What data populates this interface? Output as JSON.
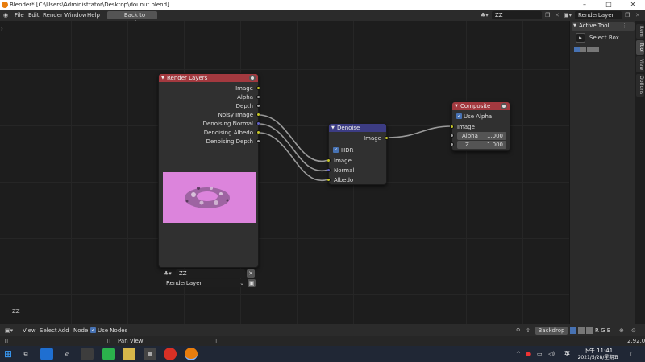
{
  "window": {
    "title": "Blender* [C:\\Users\\Administrator\\Desktop\\dounut.blend]"
  },
  "menu": {
    "file": "File",
    "edit": "Edit",
    "render": "Render",
    "window": "Window",
    "help": "Help",
    "back_button": "Back to Previous"
  },
  "scene": {
    "name": "ZZ",
    "view_layer": "RenderLayer"
  },
  "nodes": {
    "render_layers": {
      "title": "Render Layers",
      "outputs": [
        "Image",
        "Alpha",
        "Depth",
        "Noisy Image",
        "Denoising Normal",
        "Denoising Albedo",
        "Denoising Depth"
      ],
      "scene_field": "ZZ",
      "layer_field": "RenderLayer"
    },
    "denoise": {
      "title": "Denoise",
      "output": "Image",
      "hdr_label": "HDR",
      "inputs": [
        "Image",
        "Normal",
        "Albedo"
      ]
    },
    "composite": {
      "title": "Composite",
      "use_alpha_label": "Use Alpha",
      "image_label": "Image",
      "alpha_label": "Alpha",
      "alpha_value": "1.000",
      "z_label": "Z",
      "z_value": "1.000"
    }
  },
  "editor": {
    "tree_name": "ZZ"
  },
  "sidebar": {
    "panel_title": "Active Tool",
    "tool_name": "Select Box",
    "tabs": [
      "Item",
      "Tool",
      "View",
      "Options"
    ]
  },
  "footer": {
    "view": "View",
    "select": "Select",
    "add": "Add",
    "node": "Node",
    "use_nodes": "Use Nodes",
    "backdrop": "Backdrop",
    "channels": "R G B"
  },
  "status": {
    "pan_view": "Pan View",
    "version": "2.92.0"
  },
  "taskbar": {
    "ime": "英",
    "time": "下午 11:41",
    "date": "2021/5/28/星期五"
  }
}
